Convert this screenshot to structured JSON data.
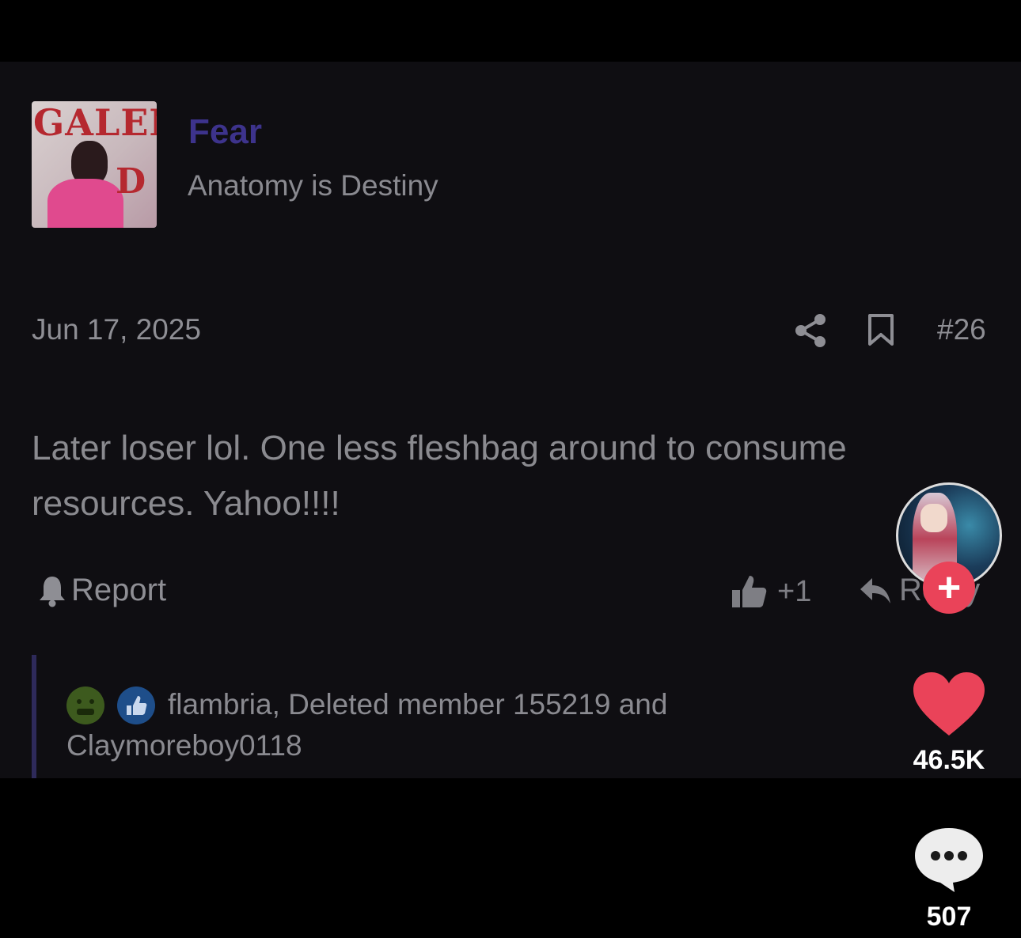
{
  "post": {
    "avatar_text_top": "GALEN",
    "avatar_text_bottom": "D",
    "username": "Fear",
    "user_title": "Anatomy is Destiny",
    "date": "Jun 17, 2025",
    "post_number": "#26",
    "body": "Later loser lol. One less fleshbag around to consume resources. Yahoo!!!!",
    "report_label": "Report",
    "like_count": "+1",
    "reply_label": "Reply",
    "reactions_line_1": "flambria, Deleted member 155219 and",
    "reactions_line_2": "Claymoreboy0118"
  },
  "overlay": {
    "follow_symbol": "+",
    "likes": "46.5K",
    "comments": "507",
    "like_color": "#ea4359"
  }
}
